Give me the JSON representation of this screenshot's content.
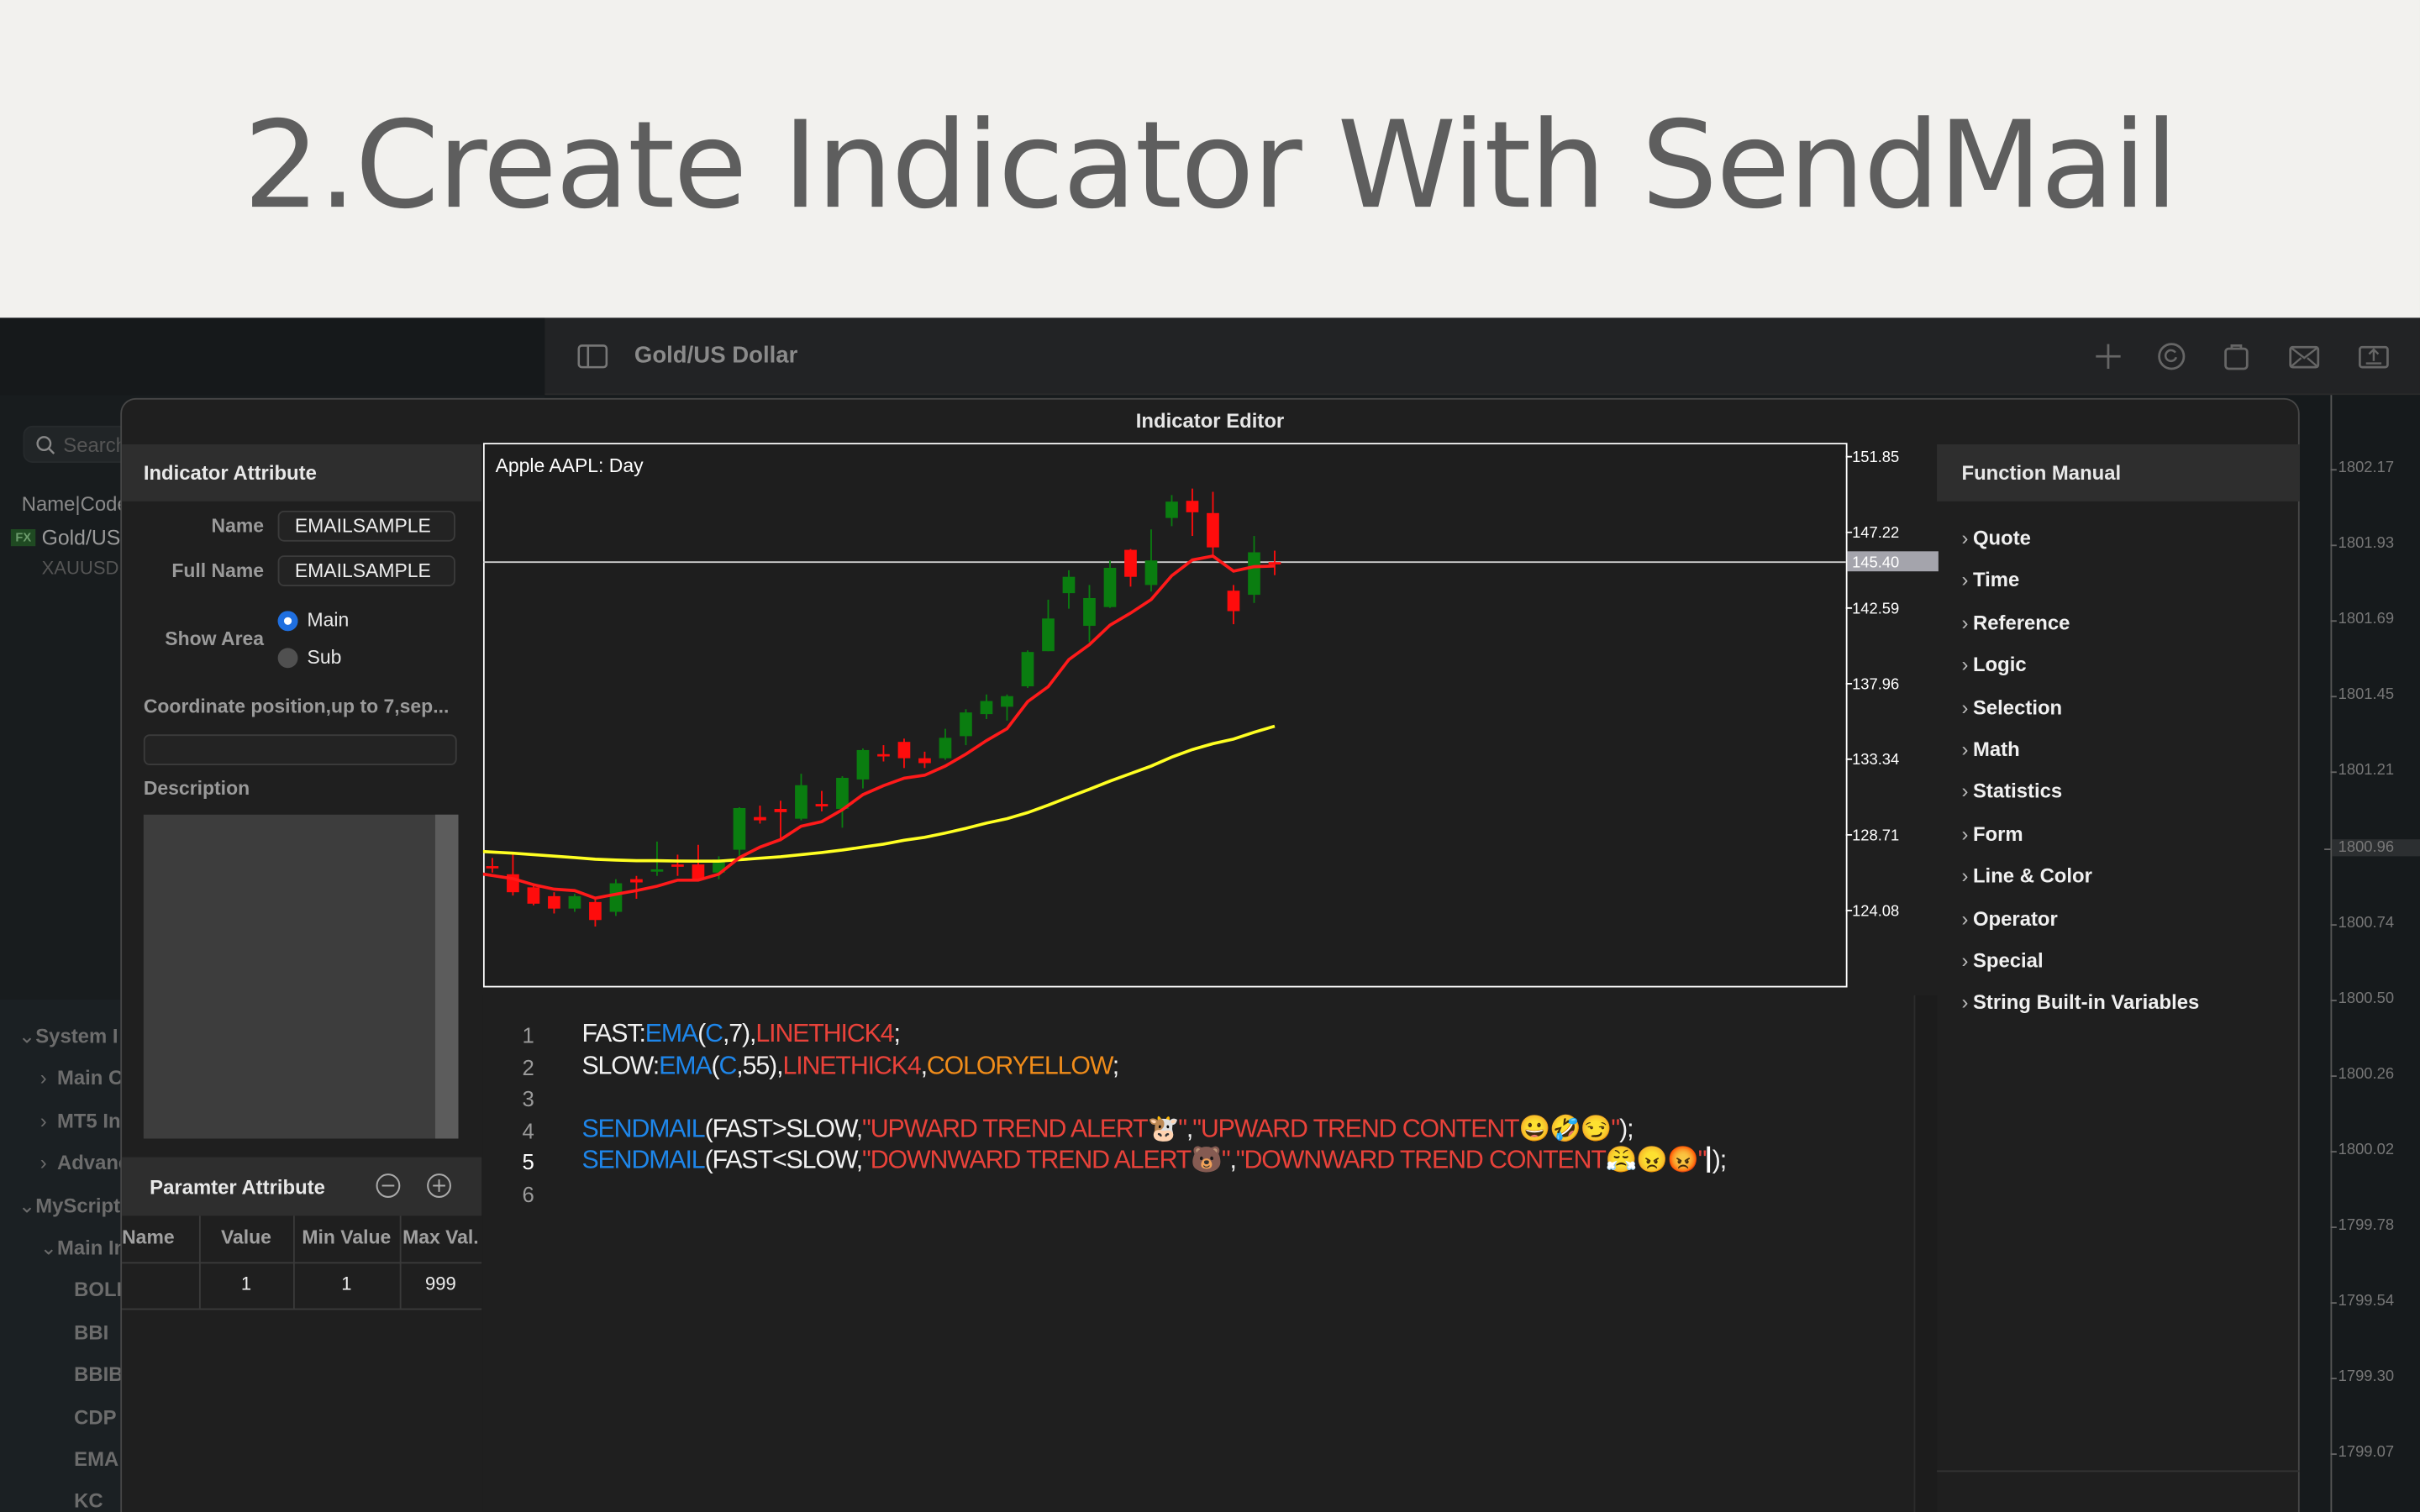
{
  "banner": {
    "title": "2.Create Indicator With SendMail"
  },
  "toolbar": {
    "title": "Gold/US Dollar",
    "icons": [
      "sidebar-toggle-icon",
      "plus-icon",
      "refresh-icon",
      "bag-icon",
      "mail-icon",
      "share-icon"
    ]
  },
  "sidebar": {
    "search_placeholder": "Search",
    "column_header": "Name|Code",
    "symbol": {
      "badge": "FX",
      "name": "Gold/US",
      "code": "XAUUSD"
    },
    "tree": [
      {
        "label": "System I",
        "level": 0,
        "expanded": true
      },
      {
        "label": "Main C",
        "level": 1,
        "expanded": false
      },
      {
        "label": "MT5 In",
        "level": 1,
        "expanded": false
      },
      {
        "label": "Advanc",
        "level": 1,
        "expanded": false
      },
      {
        "label": "MyScript",
        "level": 0,
        "expanded": true
      },
      {
        "label": "Main In",
        "level": 1,
        "expanded": true
      },
      {
        "label": "BOLL",
        "level": 2
      },
      {
        "label": "BBI",
        "level": 2
      },
      {
        "label": "BBIB",
        "level": 2
      },
      {
        "label": "CDP",
        "level": 2
      },
      {
        "label": "EMA",
        "level": 2
      },
      {
        "label": "KC",
        "level": 2
      }
    ]
  },
  "background_axis": {
    "labels": [
      "1802.17",
      "1801.93",
      "1801.69",
      "1801.45",
      "1801.21",
      "1800.96",
      "1800.74",
      "1800.50",
      "1800.26",
      "1800.02",
      "1799.78",
      "1799.54",
      "1799.30",
      "1799.07"
    ],
    "current": "1800.96"
  },
  "dialog": {
    "title": "Indicator Editor",
    "attribute": {
      "header": "Indicator Attribute",
      "name_label": "Name",
      "name_value": "EMAILSAMPLE",
      "fullname_label": "Full Name",
      "fullname_value": "EMAILSAMPLE",
      "show_area_label": "Show Area",
      "show_area_options": [
        "Main",
        "Sub"
      ],
      "show_area_selected": "Main",
      "coord_label": "Coordinate position,up to 7,sep...",
      "coord_value": "",
      "description_label": "Description",
      "description_value": ""
    },
    "params": {
      "header": "Paramter Attribute",
      "columns": [
        "Name",
        "Value",
        "Min Value",
        "Max Val."
      ],
      "rows": [
        [
          "",
          "1",
          "1",
          "999"
        ]
      ]
    },
    "function_manual": {
      "header": "Function Manual",
      "items": [
        "Quote",
        "Time",
        "Reference",
        "Logic",
        "Selection",
        "Math",
        "Statistics",
        "Form",
        "Line & Color",
        "Operator",
        "Special",
        "String Built-in Variables"
      ]
    },
    "code": {
      "current_line": 5,
      "lines": [
        [
          {
            "t": "FAST:",
            "k": "plain"
          },
          {
            "t": "EMA",
            "k": "func"
          },
          {
            "t": "(",
            "k": "plain"
          },
          {
            "t": "C",
            "k": "func"
          },
          {
            "t": ",7),",
            "k": "plain"
          },
          {
            "t": "LINETHICK4",
            "k": "red"
          },
          {
            "t": ";",
            "k": "plain"
          }
        ],
        [
          {
            "t": "SLOW:",
            "k": "plain"
          },
          {
            "t": "EMA",
            "k": "func"
          },
          {
            "t": "(",
            "k": "plain"
          },
          {
            "t": "C",
            "k": "func"
          },
          {
            "t": ",55),",
            "k": "plain"
          },
          {
            "t": "LINETHICK4",
            "k": "red"
          },
          {
            "t": ",",
            "k": "plain"
          },
          {
            "t": "COLORYELLOW",
            "k": "orange"
          },
          {
            "t": ";",
            "k": "plain"
          }
        ],
        [],
        [
          {
            "t": "SENDMAIL",
            "k": "func"
          },
          {
            "t": "(FAST>SLOW,",
            "k": "plain"
          },
          {
            "t": "\"UPWARD TREND ALERT🐮\"",
            "k": "red"
          },
          {
            "t": ",",
            "k": "plain"
          },
          {
            "t": "\"UPWARD TREND CONTENT😀🤣😏\"",
            "k": "red"
          },
          {
            "t": ");",
            "k": "plain"
          }
        ],
        [
          {
            "t": "SENDMAIL",
            "k": "func"
          },
          {
            "t": "(FAST<SLOW,",
            "k": "plain"
          },
          {
            "t": "\"DOWNWARD TREND ALERT🐻\"",
            "k": "red"
          },
          {
            "t": ",",
            "k": "plain"
          },
          {
            "t": "\"DOWNWARD TREND CONTENT😤😠😡\"",
            "k": "red"
          },
          {
            "t": ");",
            "k": "plain"
          }
        ],
        []
      ]
    }
  },
  "chart_data": {
    "type": "candlestick",
    "title": "Apple AAPL: Day",
    "ylim": [
      119.47,
      152.7
    ],
    "yticks": [
      "151.85",
      "147.22",
      "142.59",
      "137.96",
      "133.34",
      "128.71",
      "124.08"
    ],
    "last_price": "145.40",
    "colors": {
      "up": "#0a7d10",
      "down": "#ff0c0c",
      "fast": "#ff1a1a",
      "slow": "#ffff22"
    },
    "ohlc": [
      [
        126.8,
        127.3,
        126.4,
        126.8
      ],
      [
        126.3,
        127.5,
        125.0,
        125.2
      ],
      [
        125.5,
        125.6,
        124.4,
        124.5
      ],
      [
        124.96,
        125.2,
        123.9,
        124.2
      ],
      [
        124.2,
        125.1,
        124.0,
        124.96
      ],
      [
        124.6,
        124.8,
        123.1,
        123.5
      ],
      [
        124.0,
        126.0,
        123.75,
        125.75
      ],
      [
        126.0,
        126.2,
        124.8,
        125.8
      ],
      [
        126.5,
        128.3,
        126.2,
        126.6
      ],
      [
        126.9,
        127.5,
        126.2,
        126.9
      ],
      [
        126.9,
        128.1,
        125.9,
        126.0
      ],
      [
        126.4,
        127.4,
        126.0,
        127.2
      ],
      [
        127.8,
        130.4,
        127.3,
        130.35
      ],
      [
        129.8,
        130.5,
        129.4,
        129.6
      ],
      [
        130.3,
        130.8,
        128.5,
        130.1
      ],
      [
        129.7,
        132.45,
        129.6,
        131.75
      ],
      [
        130.6,
        131.4,
        130.15,
        130.45
      ],
      [
        130.3,
        132.3,
        129.15,
        132.2
      ],
      [
        132.1,
        134.0,
        131.55,
        133.9
      ],
      [
        133.65,
        134.2,
        133.2,
        133.65
      ],
      [
        134.4,
        134.6,
        132.8,
        133.4
      ],
      [
        133.4,
        133.8,
        132.8,
        133.1
      ],
      [
        133.4,
        135.2,
        133.3,
        134.65
      ],
      [
        134.75,
        136.4,
        134.2,
        136.2
      ],
      [
        136.1,
        137.3,
        135.8,
        136.9
      ],
      [
        136.55,
        137.3,
        135.7,
        137.2
      ],
      [
        137.8,
        140.0,
        137.7,
        139.9
      ],
      [
        139.95,
        143.1,
        139.95,
        141.95
      ],
      [
        143.5,
        144.9,
        142.55,
        144.5
      ],
      [
        141.5,
        144.0,
        140.5,
        143.2
      ],
      [
        142.65,
        145.5,
        142.6,
        145.05
      ],
      [
        146.15,
        146.2,
        143.9,
        144.5
      ],
      [
        144.0,
        147.4,
        143.6,
        145.5
      ],
      [
        148.1,
        149.5,
        147.6,
        149.1
      ],
      [
        149.15,
        149.9,
        147.0,
        148.45
      ],
      [
        148.4,
        149.7,
        145.7,
        146.3
      ],
      [
        143.65,
        144.0,
        141.6,
        142.4
      ],
      [
        143.4,
        147.0,
        142.9,
        146.0
      ],
      [
        145.4,
        146.1,
        144.6,
        145.4
      ]
    ],
    "series": [
      {
        "name": "FAST",
        "values": [
          126.4,
          126.03,
          125.66,
          125.39,
          125.3,
          124.84,
          125.08,
          125.3,
          125.57,
          125.94,
          125.94,
          126.31,
          127.32,
          127.96,
          128.42,
          129.24,
          129.52,
          130.25,
          131.17,
          131.72,
          132.18,
          132.36,
          132.92,
          133.65,
          134.48,
          135.21,
          136.86,
          137.78,
          139.43,
          140.35,
          141.54,
          142.28,
          143.11,
          144.57,
          145.53,
          145.77,
          144.85,
          145.12,
          145.16
        ]
      },
      {
        "name": "SLOW",
        "values": [
          127.72,
          127.59,
          127.5,
          127.41,
          127.32,
          127.22,
          127.17,
          127.13,
          127.13,
          127.11,
          127.1,
          127.1,
          127.19,
          127.28,
          127.37,
          127.5,
          127.63,
          127.78,
          127.96,
          128.14,
          128.38,
          128.56,
          128.82,
          129.11,
          129.43,
          129.7,
          130.07,
          130.53,
          131.02,
          131.5,
          132.0,
          132.46,
          132.92,
          133.47,
          133.93,
          134.29,
          134.57,
          134.99,
          135.36
        ]
      }
    ]
  }
}
